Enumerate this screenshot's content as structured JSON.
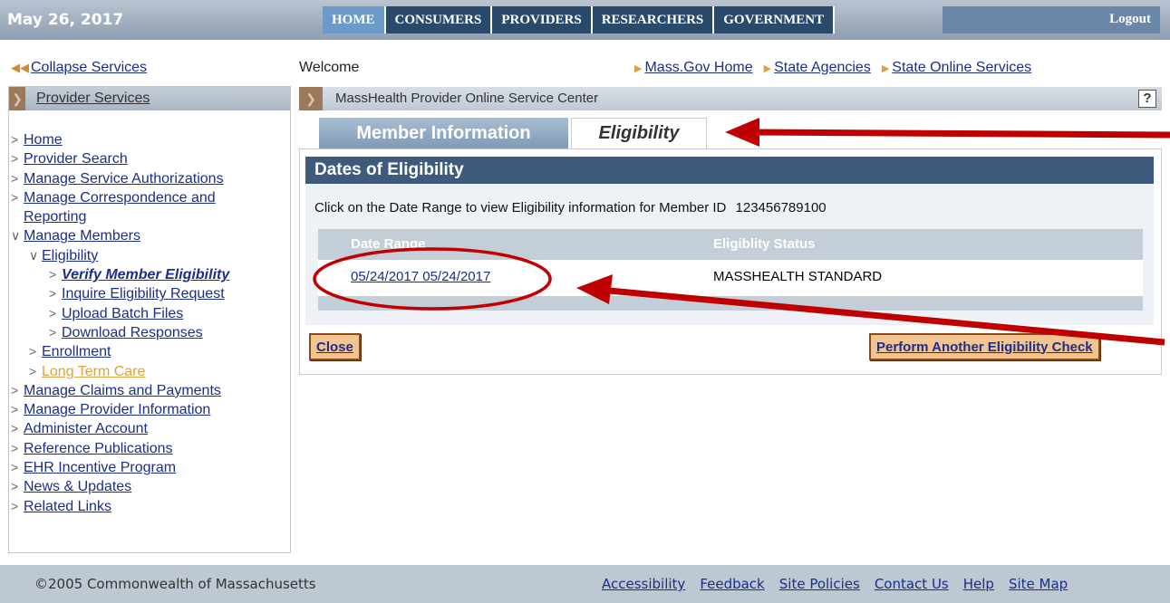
{
  "topbar": {
    "date": "May 26, 2017",
    "tabs": [
      "HOME",
      "CONSUMERS",
      "PROVIDERS",
      "RESEARCHERS",
      "GOVERNMENT"
    ],
    "active_tab": "HOME",
    "logout": "Logout"
  },
  "left": {
    "collapse": "Collapse Services",
    "header": "Provider Services",
    "menu": [
      {
        "label": "Home",
        "level": 0
      },
      {
        "label": "Provider Search",
        "level": 0
      },
      {
        "label": "Manage Service Authorizations",
        "level": 0
      },
      {
        "label": "Manage Correspondence and",
        "level": 0
      },
      {
        "label": "Reporting",
        "level": 0,
        "continuation": true
      },
      {
        "label": "Manage Members",
        "level": 0,
        "expanded": true
      },
      {
        "label": "Eligibility",
        "level": 1,
        "expanded": true
      },
      {
        "label": "Verify Member Eligibility",
        "level": 2,
        "current": true
      },
      {
        "label": "Inquire Eligibility Request",
        "level": 2
      },
      {
        "label": "Upload Batch Files",
        "level": 2
      },
      {
        "label": "Download Responses",
        "level": 2
      },
      {
        "label": "Enrollment",
        "level": 1
      },
      {
        "label": "Long Term Care",
        "level": 1,
        "color": "#e0a040"
      },
      {
        "label": "Manage Claims and Payments",
        "level": 0
      },
      {
        "label": "Manage Provider Information",
        "level": 0
      },
      {
        "label": "Administer Account",
        "level": 0
      },
      {
        "label": "Reference Publications",
        "level": 0
      },
      {
        "label": "EHR Incentive Program",
        "level": 0
      },
      {
        "label": "News & Updates",
        "level": 0
      },
      {
        "label": "Related Links",
        "level": 0
      }
    ]
  },
  "main": {
    "welcome": "Welcome",
    "toplinks": [
      "Mass.Gov Home",
      "State Agencies",
      "State Online Services"
    ],
    "breadcrumb": "MassHealth Provider Online Service Center",
    "help": "?",
    "tabs": [
      "Member Information",
      "Eligibility"
    ],
    "active_tab": "Eligibility",
    "panel_title": "Dates of Eligibility",
    "instruction": "Click on the Date Range to view Eligibility information for Member ID",
    "member_id": "123456789100",
    "table": {
      "headers": [
        "Date Range",
        "Eligiblity Status"
      ],
      "rows": [
        [
          "05/24/2017 05/24/2017",
          "MASSHEALTH STANDARD"
        ]
      ]
    },
    "close_button": "Close",
    "perform_button": "Perform Another Eligibility Check"
  },
  "footer": {
    "copyright": "©2005 Commonwealth of Massachusetts",
    "links": [
      "Accessibility",
      "Feedback",
      "Site Policies",
      "Contact Us",
      "Help",
      "Site Map"
    ]
  },
  "annotation_color": "#c00000"
}
